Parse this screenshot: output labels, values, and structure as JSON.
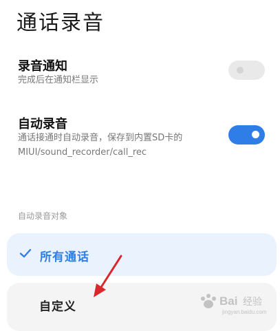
{
  "header": {
    "title": "通话录音"
  },
  "settings": {
    "record_notify": {
      "title": "录音通知",
      "desc": "完成后在通知栏显示",
      "enabled": false
    },
    "auto_record": {
      "title": "自动录音",
      "desc_line1": "通话接通时自动录音，保存到内置SD卡的",
      "desc_line2": "MIUI/sound_recorder/call_rec",
      "enabled": true
    }
  },
  "target_section": {
    "label": "自动录音对象",
    "options": [
      {
        "label": "所有通话",
        "selected": true
      },
      {
        "label": "自定义",
        "selected": false
      }
    ]
  },
  "colors": {
    "accent": "#2f7de6",
    "annotation_arrow": "#d9272e"
  },
  "icons": {
    "check": "check-icon",
    "arrow": "red-arrow-icon"
  },
  "watermark": {
    "text": "Baidu经验",
    "subtext": "jingyan.baidu.com"
  }
}
